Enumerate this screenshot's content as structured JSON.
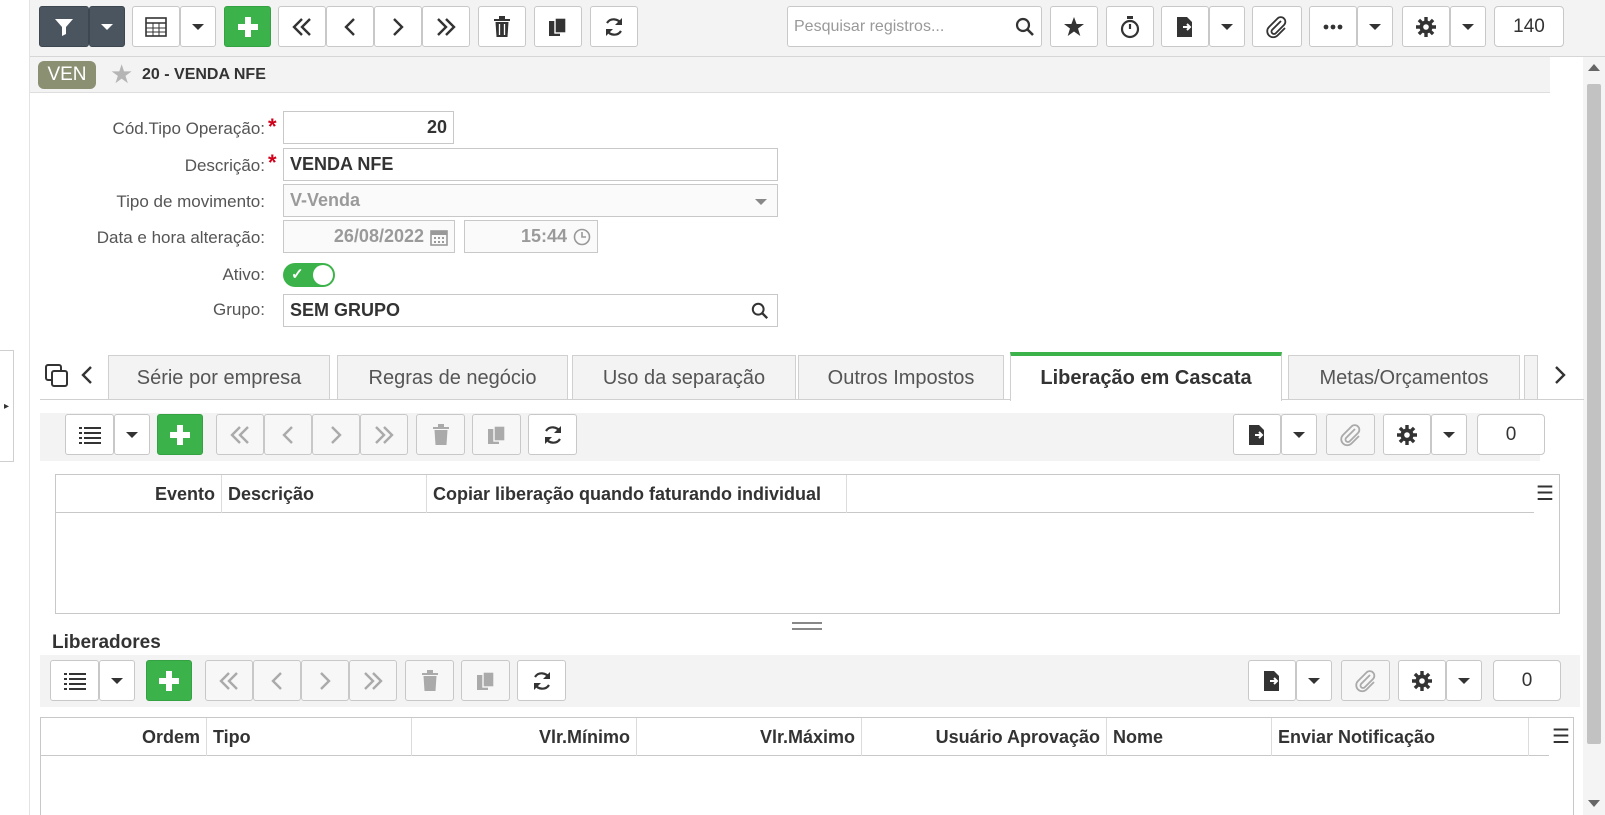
{
  "toolbar": {
    "search_placeholder": "Pesquisar registros...",
    "record_count": "140"
  },
  "header": {
    "badge": "VEN",
    "record_title": "20 - VENDA NFE"
  },
  "form": {
    "cod_tipo_label": "Cód.Tipo Operação:",
    "cod_tipo_value": "20",
    "descricao_label": "Descrição:",
    "descricao_value": "VENDA NFE",
    "tipo_mov_label": "Tipo de movimento:",
    "tipo_mov_value": "V-Venda",
    "data_label": "Data e hora alteração:",
    "data_value": "26/08/2022",
    "hora_value": "15:44",
    "ativo_label": "Ativo:",
    "ativo_checked": true,
    "grupo_label": "Grupo:",
    "grupo_value": "SEM GRUPO"
  },
  "tabs": [
    {
      "label": "Série por empresa"
    },
    {
      "label": "Regras de negócio"
    },
    {
      "label": "Uso da separação"
    },
    {
      "label": "Outros Impostos"
    },
    {
      "label": "Liberação em Cascata",
      "active": true
    },
    {
      "label": "Metas/Orçamentos"
    }
  ],
  "cascata_grid": {
    "record_count": "0",
    "columns": [
      "Evento",
      "Descrição",
      "Copiar liberação quando faturando individual"
    ]
  },
  "liberadores": {
    "title": "Liberadores",
    "record_count": "0",
    "columns": [
      "Ordem",
      "Tipo",
      "Vlr.Mínimo",
      "Vlr.Máximo",
      "Usuário Aprovação",
      "Nome",
      "Enviar Notificação"
    ]
  },
  "colors": {
    "accent_green": "#3cb34a",
    "dark_button": "#4a5560",
    "badge": "#8b9073",
    "required": "#d0021b"
  }
}
